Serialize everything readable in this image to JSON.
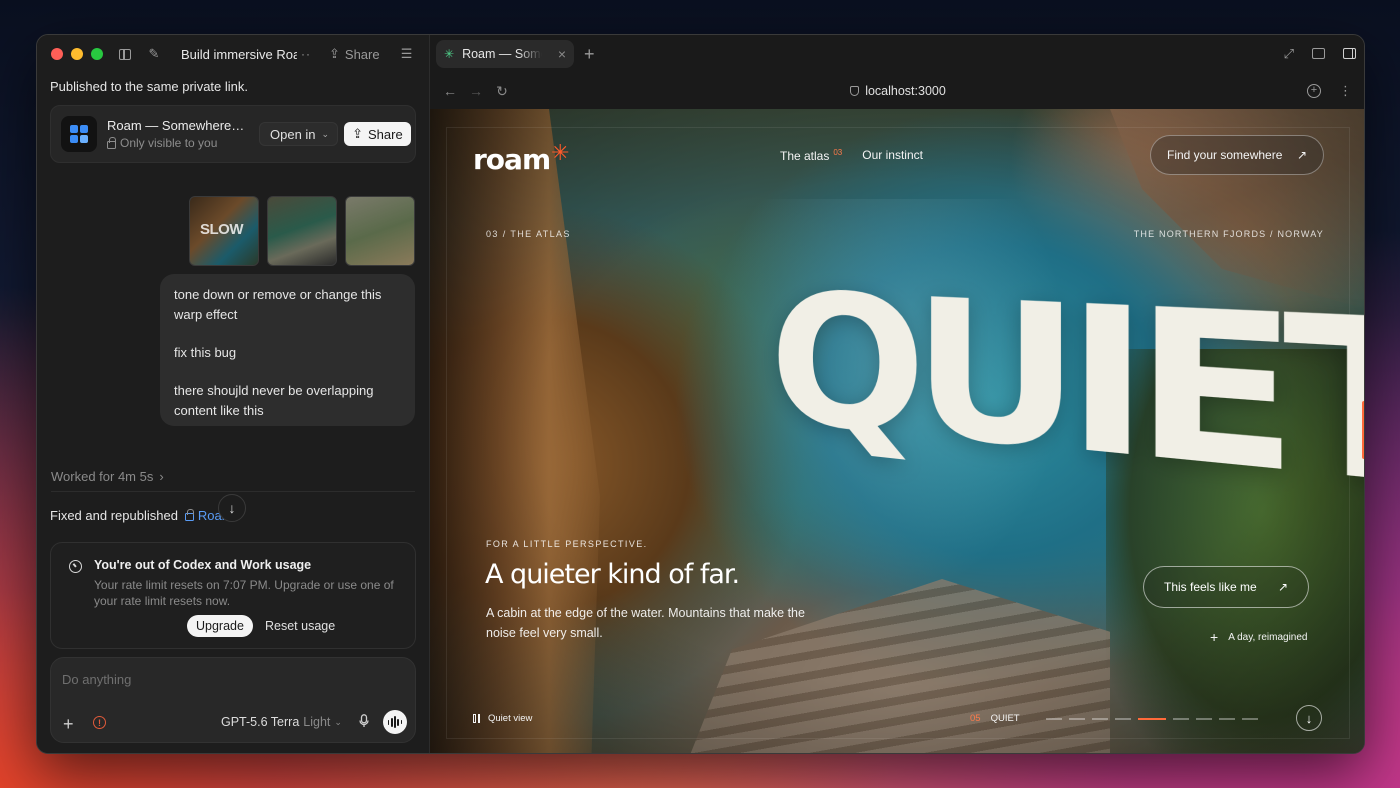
{
  "left": {
    "chat_title": "Build immersive Roa",
    "share_label": "Share",
    "published_text": "Published to the same private link.",
    "link_card": {
      "title": "Roam — Somewhere t...",
      "visibility": "Only visible to you",
      "open_in_label": "Open in",
      "share_label": "Share"
    },
    "thumbnails": [
      {
        "label": "SLOW"
      },
      {
        "label": ""
      },
      {
        "label": ""
      }
    ],
    "user_message": [
      "tone down or remove or change this warp effect",
      "fix this bug",
      "there shoujld never be overlapping content like this"
    ],
    "worked_for": "Worked for 4m 5s",
    "fixed_text": "Fixed and republished",
    "fixed_link": "Roam",
    "usage": {
      "title": "You're out of Codex and Work usage",
      "text": "Your rate limit resets on 7:07 PM. Upgrade or use one of your rate limit resets now.",
      "upgrade_label": "Upgrade",
      "reset_label": "Reset usage"
    },
    "composer": {
      "placeholder": "Do anything",
      "model": "GPT-5.6 Terra",
      "model_mode": "Light"
    }
  },
  "browser": {
    "tab_title": "Roam — Somewhere",
    "url": "localhost:3000"
  },
  "site": {
    "logo": "roam",
    "nav": [
      {
        "label": "The atlas",
        "sup": "03"
      },
      {
        "label": "Our instinct",
        "sup": ""
      }
    ],
    "cta": "Find your somewhere",
    "eyebrow_left": "03 / THE ATLAS",
    "eyebrow_right": "THE NORTHERN FJORDS / NORWAY",
    "hero_word": "QUIET",
    "perspective": "FOR A LITTLE PERSPECTIVE.",
    "headline": "A quieter kind of far.",
    "subcopy": "A cabin at the edge of the water. Mountains that make the noise feel very small.",
    "feels_btn": "This feels like me",
    "day_label": "A day, reimagined",
    "quiet_view": "Quiet view",
    "slide_num": "05",
    "slide_label": "QUIET",
    "slide_total": 9,
    "slide_active_index": 4
  }
}
